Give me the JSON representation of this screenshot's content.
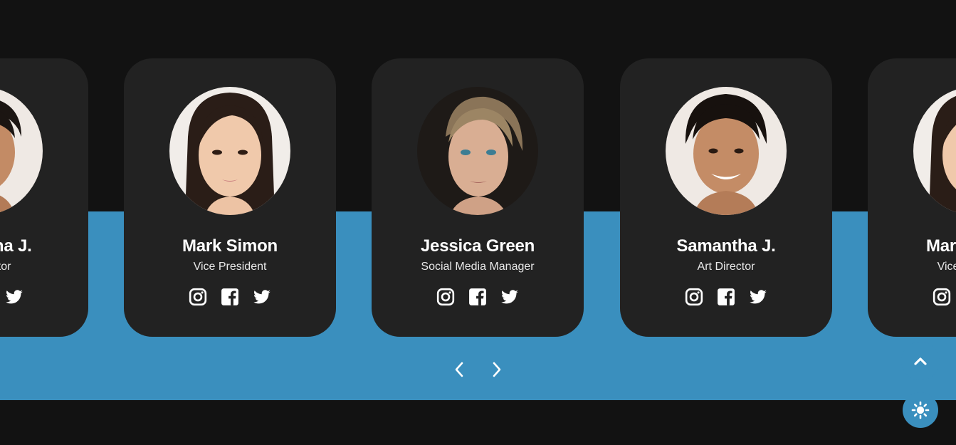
{
  "team": {
    "members": [
      {
        "name": "Samantha J.",
        "role": "Art Director",
        "avatar": "man-smiling-avatar"
      },
      {
        "name": "Mark Simon",
        "role": "Vice President",
        "avatar": "woman-dark-hair-avatar"
      },
      {
        "name": "Jessica Green",
        "role": "Social Media Manager",
        "avatar": "woman-blonde-avatar"
      },
      {
        "name": "Samantha J.",
        "role": "Art Director",
        "avatar": "man-smiling-avatar"
      },
      {
        "name": "Mark Simon",
        "role": "Vice President",
        "avatar": "woman-dark-hair-avatar"
      }
    ],
    "social_icons": [
      "instagram-icon",
      "facebook-icon",
      "twitter-icon"
    ]
  },
  "slider": {
    "prev_icon": "chevron-left-icon",
    "next_icon": "chevron-right-icon"
  },
  "floating": {
    "scroll_top_icon": "chevron-up-icon",
    "theme_icon": "sun-icon"
  },
  "colors": {
    "background": "#121212",
    "band": "#3a8fbe",
    "card": "#222222",
    "text": "#ffffff"
  }
}
